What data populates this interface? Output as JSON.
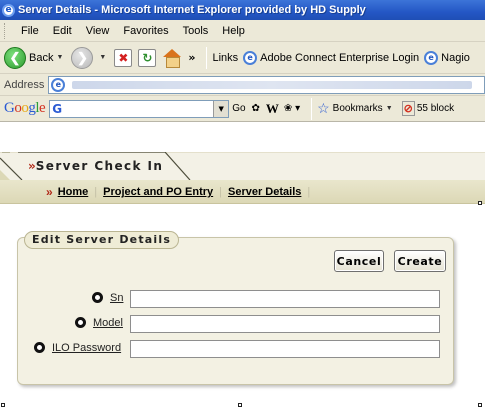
{
  "window": {
    "title": "Server Details - Microsoft Internet Explorer provided by HD Supply",
    "menu": [
      "File",
      "Edit",
      "View",
      "Favorites",
      "Tools",
      "Help"
    ]
  },
  "toolbar": {
    "back_label": "Back",
    "links_label": "Links",
    "link_1": "Adobe Connect Enterprise Login",
    "link_2": "Nagio"
  },
  "addressbar": {
    "label": "Address"
  },
  "googlebar": {
    "logo": [
      "G",
      "o",
      "o",
      "g",
      "l",
      "e"
    ],
    "search_icon": "G",
    "go_label": "Go",
    "bookmarks_label": "Bookmarks",
    "blocked_label": "55 block"
  },
  "tab": {
    "arrow": "»",
    "label": "Server Check In"
  },
  "breadcrumb": {
    "lead": "»",
    "items": [
      "Home",
      "Project and PO Entry",
      "Server Details"
    ]
  },
  "panel": {
    "title": "Edit Server Details",
    "cancel_label": "Cancel",
    "create_label": "Create",
    "fields": [
      {
        "label": "Sn",
        "value": ""
      },
      {
        "label": "Model",
        "value": ""
      },
      {
        "label": "ILO Password",
        "value": ""
      }
    ]
  },
  "colors": {
    "title_bar": "#2457c5",
    "chrome": "#ece9d8",
    "breadcrumb_bar": "#dcd8b6",
    "panel": "#f3f1e3",
    "accent_arrow": "#b12a1a"
  }
}
